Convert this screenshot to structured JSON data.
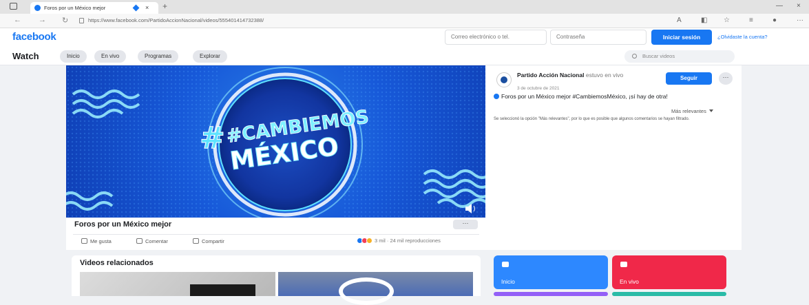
{
  "browser": {
    "tab_title": "Foros por un México mejor",
    "tab_close": "×",
    "new_tab": "+",
    "url": "https://www.facebook.com/PartidoAccionNacional/videos/555401414732388/",
    "win_min": "—",
    "win_close": "×"
  },
  "header": {
    "logo": "facebook",
    "email_placeholder": "Correo electrónico o tel.",
    "password_placeholder": "Contraseña",
    "login_label": "Iniciar sesión",
    "forgot_label": "¿Olvidaste la cuenta?"
  },
  "watch": {
    "title": "Watch",
    "nav": [
      "Inicio",
      "En vivo",
      "Programas",
      "Explorar"
    ],
    "search_placeholder": "Buscar videos"
  },
  "post": {
    "video_text_line1": "#CAMBIEMOS",
    "video_text_line2": "MÉXICO",
    "title": "Foros por un México mejor",
    "more": "···",
    "actions": [
      "Me gusta",
      "Comentar",
      "Compartir"
    ],
    "stats": "3 mil · 24 mil reproducciones"
  },
  "side": {
    "page_name": "Partido Acción Nacional",
    "live_text": "estuvo en vivo",
    "date": "3 de octubre de 2021",
    "follow_label": "Seguir",
    "more": "···",
    "description": "Foros por un México mejor #CambiemosMéxico, ¡sí hay de otra!",
    "sort_label": "Más relevantes",
    "sort_note": "Se seleccionó la opción \"Más relevantes\", por lo que es posible que algunos comentarios se hayan filtrado."
  },
  "related": {
    "title": "Videos relacionados"
  },
  "tiles": [
    {
      "label": "Inicio",
      "color": "#2d88ff"
    },
    {
      "label": "En vivo",
      "color": "#f02849"
    },
    {
      "label": "",
      "color": "#9360f7"
    },
    {
      "label": "",
      "color": "#2abba7"
    }
  ]
}
